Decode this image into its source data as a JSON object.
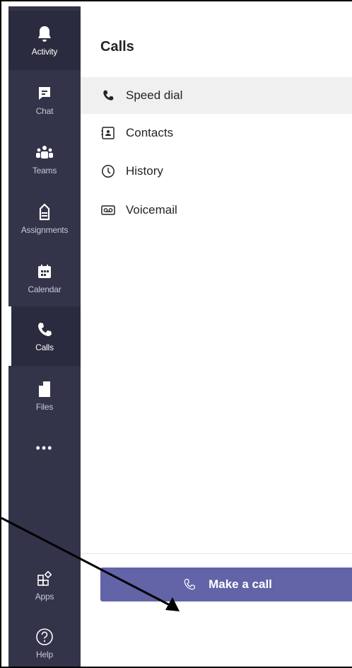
{
  "rail": {
    "items": [
      {
        "label": "Activity",
        "icon": "bell-icon"
      },
      {
        "label": "Chat",
        "icon": "chat-icon"
      },
      {
        "label": "Teams",
        "icon": "teams-icon"
      },
      {
        "label": "Assignments",
        "icon": "backpack-icon"
      },
      {
        "label": "Calendar",
        "icon": "calendar-icon"
      },
      {
        "label": "Calls",
        "icon": "phone-icon"
      },
      {
        "label": "Files",
        "icon": "file-icon"
      },
      {
        "label": "Apps",
        "icon": "apps-icon"
      },
      {
        "label": "Help",
        "icon": "help-icon"
      }
    ],
    "more_glyph": "•••"
  },
  "panel": {
    "title": "Calls",
    "nav": [
      {
        "label": "Speed dial",
        "icon": "phone-icon"
      },
      {
        "label": "Contacts",
        "icon": "contact-card-icon"
      },
      {
        "label": "History",
        "icon": "clock-icon"
      },
      {
        "label": "Voicemail",
        "icon": "voicemail-icon"
      }
    ],
    "make_call_label": "Make a call"
  },
  "colors": {
    "rail_bg": "#33344a",
    "rail_active": "#2a2b3e",
    "accent": "#6264a7",
    "selected_row": "#f0f0f0"
  }
}
